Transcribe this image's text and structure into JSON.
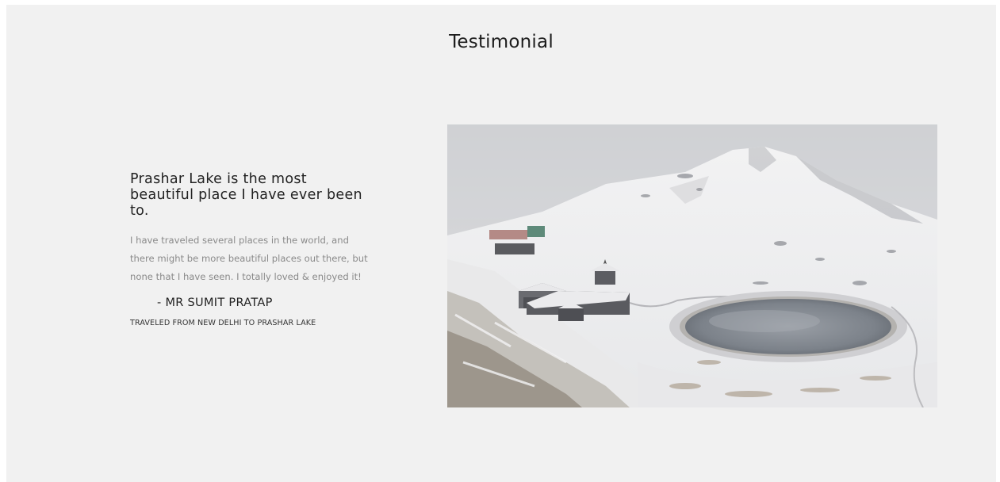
{
  "section": {
    "title": "Testimonial"
  },
  "testimonial": {
    "headline": "Prashar Lake is the most beautiful place I have ever been to.",
    "body": "I have traveled several places in the world, and there might be more beautiful places out there, but none that I have seen. I totally loved & enjoyed it!",
    "author": "- MR SUMIT PRATAP",
    "route": "TRAVELED FROM NEW DELHI TO PRASHAR LAKE"
  },
  "photo": {
    "subject": "snow-covered mountain with lake and temple"
  },
  "colors": {
    "background": "#f1f1f1",
    "heading": "#1d1d1d",
    "body_text": "#8a8a8a"
  }
}
